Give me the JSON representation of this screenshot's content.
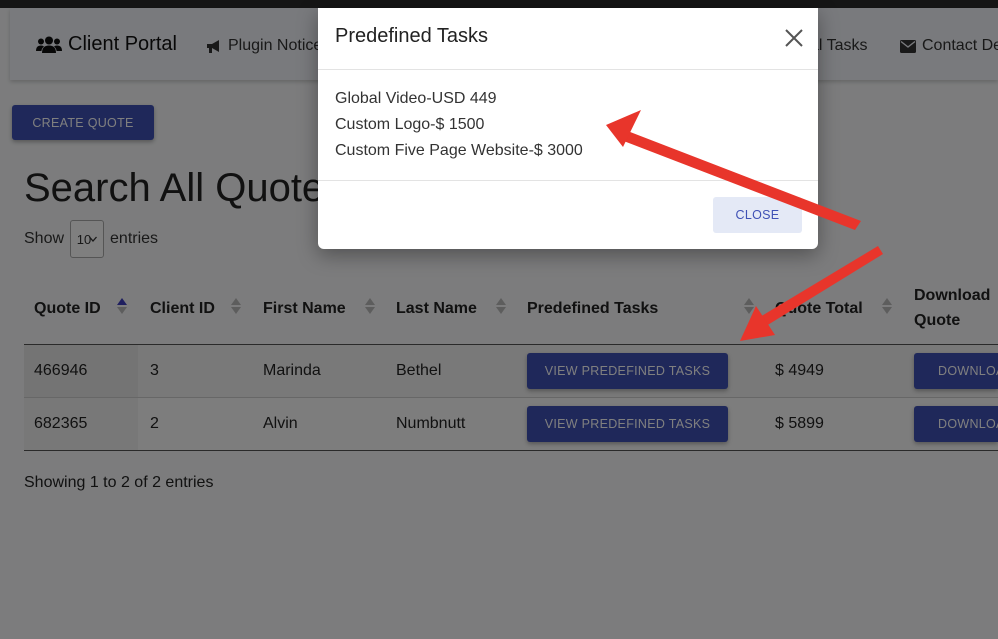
{
  "nav": {
    "brand": "Client Portal",
    "links": [
      {
        "label": "Plugin Notice",
        "icon": "megaphone-icon"
      },
      {
        "label": "al Tasks",
        "icon": ""
      },
      {
        "label": "Contact De",
        "icon": "envelope-icon"
      }
    ]
  },
  "create_quote_label": "CREATE QUOTE",
  "page_title": "Search All Quote",
  "show_entries": {
    "prefix": "Show",
    "value": "10",
    "suffix": "entries"
  },
  "table": {
    "columns": [
      "Quote ID",
      "Client ID",
      "First Name",
      "Last Name",
      "Predefined Tasks",
      "Quote Total",
      "Download Quote"
    ],
    "rows": [
      {
        "quote_id": "466946",
        "client_id": "3",
        "first_name": "Marinda",
        "last_name": "Bethel",
        "tasks_button": "VIEW PREDEFINED TASKS",
        "total": "$ 4949",
        "download_button": "DOWNLOAD"
      },
      {
        "quote_id": "682365",
        "client_id": "2",
        "first_name": "Alvin",
        "last_name": "Numbnutt",
        "tasks_button": "VIEW PREDEFINED TASKS",
        "total": "$ 5899",
        "download_button": "DOWNLOAD"
      }
    ],
    "info": "Showing 1 to 2 of 2 entries"
  },
  "modal": {
    "title": "Predefined Tasks",
    "tasks": [
      "Global Video-USD 449",
      "Custom Logo-$ 1500",
      "Custom Five Page Website-$ 3000"
    ],
    "close_label": "CLOSE"
  },
  "colors": {
    "primary": "#3f51b5",
    "annotation_arrow": "#e8352b",
    "sort_active": "#3f3fbf"
  }
}
